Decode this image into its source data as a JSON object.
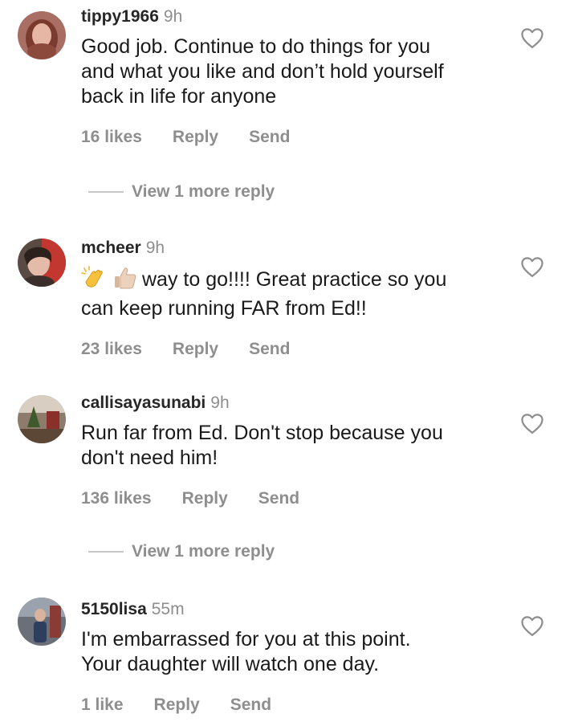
{
  "comments": [
    {
      "username": "tippy1966",
      "time": "9h",
      "text_lines": [
        "Good job.  Continue to do things for you",
        "and what you like and don’t hold yourself",
        "back in life for anyone"
      ],
      "likes": "16 likes",
      "reply": "Reply",
      "send": "Send",
      "view_more": "View 1 more reply"
    },
    {
      "username": "mcheer",
      "time": "9h",
      "emoji_icons": [
        "clapping-hands-icon",
        "thumbs-up-icon"
      ],
      "text_lines": [
        "way to go!!!! Great practice so you",
        "can keep running FAR from Ed!!"
      ],
      "likes": "23 likes",
      "reply": "Reply",
      "send": "Send"
    },
    {
      "username": "callisayasunabi",
      "time": "9h",
      "text_lines": [
        "Run far from Ed. Don't stop because you",
        "don't need him!"
      ],
      "likes": "136 likes",
      "reply": "Reply",
      "send": "Send",
      "view_more": "View 1 more reply"
    },
    {
      "username": "5150lisa",
      "time": "55m",
      "text_lines": [
        "I'm embarrassed for you at this point.",
        "Your daughter will watch one day."
      ],
      "likes": "1 like",
      "reply": "Reply",
      "send": "Send"
    }
  ],
  "colors": {
    "text": "#262626",
    "muted": "#8e8e8e",
    "divider": "#c7c7c7"
  }
}
